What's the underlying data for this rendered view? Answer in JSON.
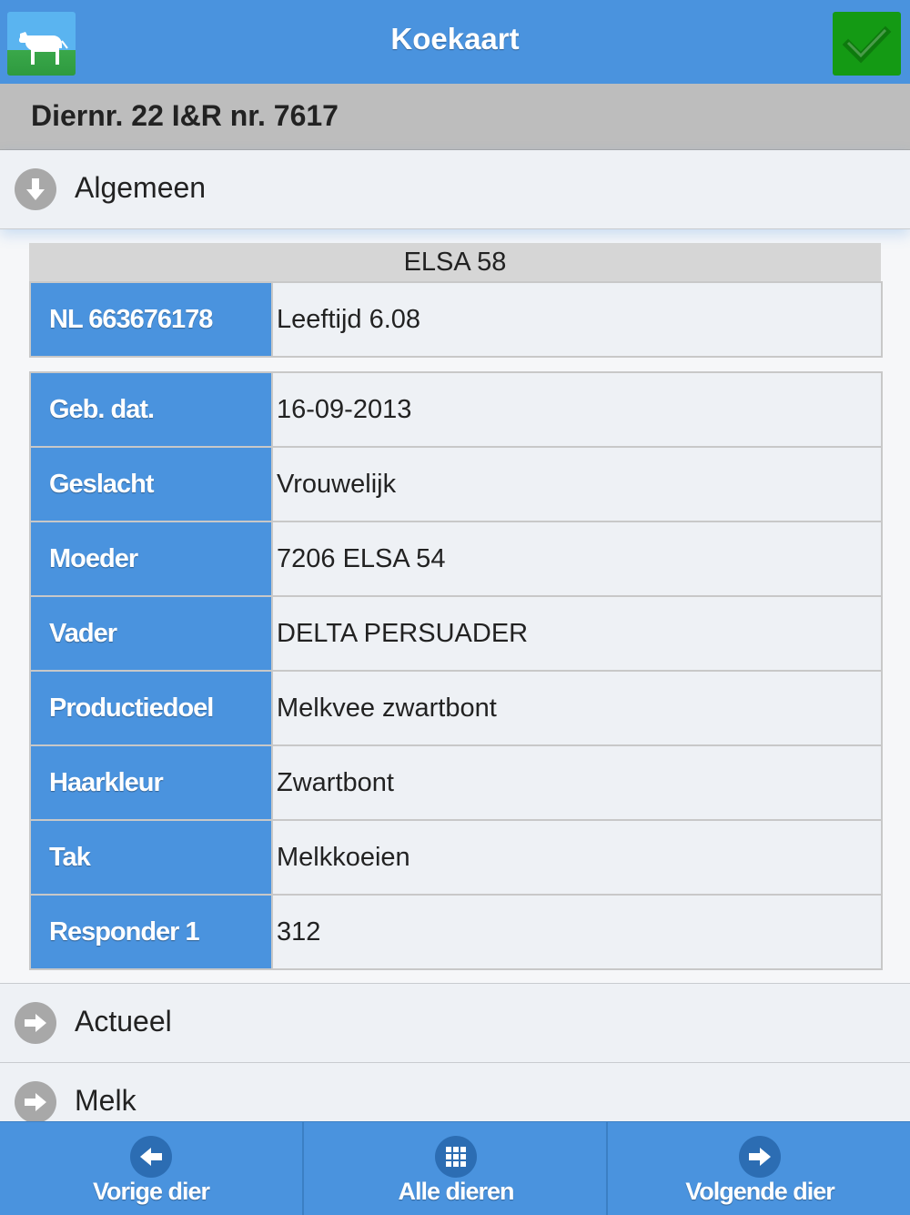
{
  "header": {
    "title": "Koekaart",
    "logo_icon": "cow-icon",
    "confirm_icon": "checkmark-icon"
  },
  "subheader": {
    "text": "Diernr. 22 I&R nr. 7617"
  },
  "sections": {
    "algemeen": {
      "label": "Algemeen",
      "icon": "arrow-down-circle-icon",
      "expanded": true
    },
    "actueel": {
      "label": "Actueel",
      "icon": "arrow-right-circle-icon",
      "expanded": false
    },
    "melk": {
      "label": "Melk",
      "icon": "arrow-right-circle-icon",
      "expanded": false
    }
  },
  "card": {
    "name": "ELSA 58",
    "id_label": "NL 663676178",
    "age": "Leeftijd 6.08"
  },
  "details": [
    {
      "key": "Geb. dat.",
      "value": "16-09-2013"
    },
    {
      "key": "Geslacht",
      "value": "Vrouwelijk"
    },
    {
      "key": "Moeder",
      "value": "7206 ELSA 54"
    },
    {
      "key": "Vader",
      "value": "DELTA PERSUADER"
    },
    {
      "key": "Productiedoel",
      "value": "Melkvee zwartbont"
    },
    {
      "key": "Haarkleur",
      "value": "Zwartbont"
    },
    {
      "key": "Tak",
      "value": "Melkkoeien"
    },
    {
      "key": "Responder 1",
      "value": "312"
    }
  ],
  "footer": {
    "prev": {
      "label": "Vorige dier",
      "icon": "arrow-left-circle-icon"
    },
    "all": {
      "label": "Alle dieren",
      "icon": "grid-icon"
    },
    "next": {
      "label": "Volgende dier",
      "icon": "arrow-right-circle-icon"
    }
  },
  "colors": {
    "header_blue": "#4a93de",
    "confirm_green": "#149a14",
    "subheader_gray": "#bdbdbd"
  }
}
